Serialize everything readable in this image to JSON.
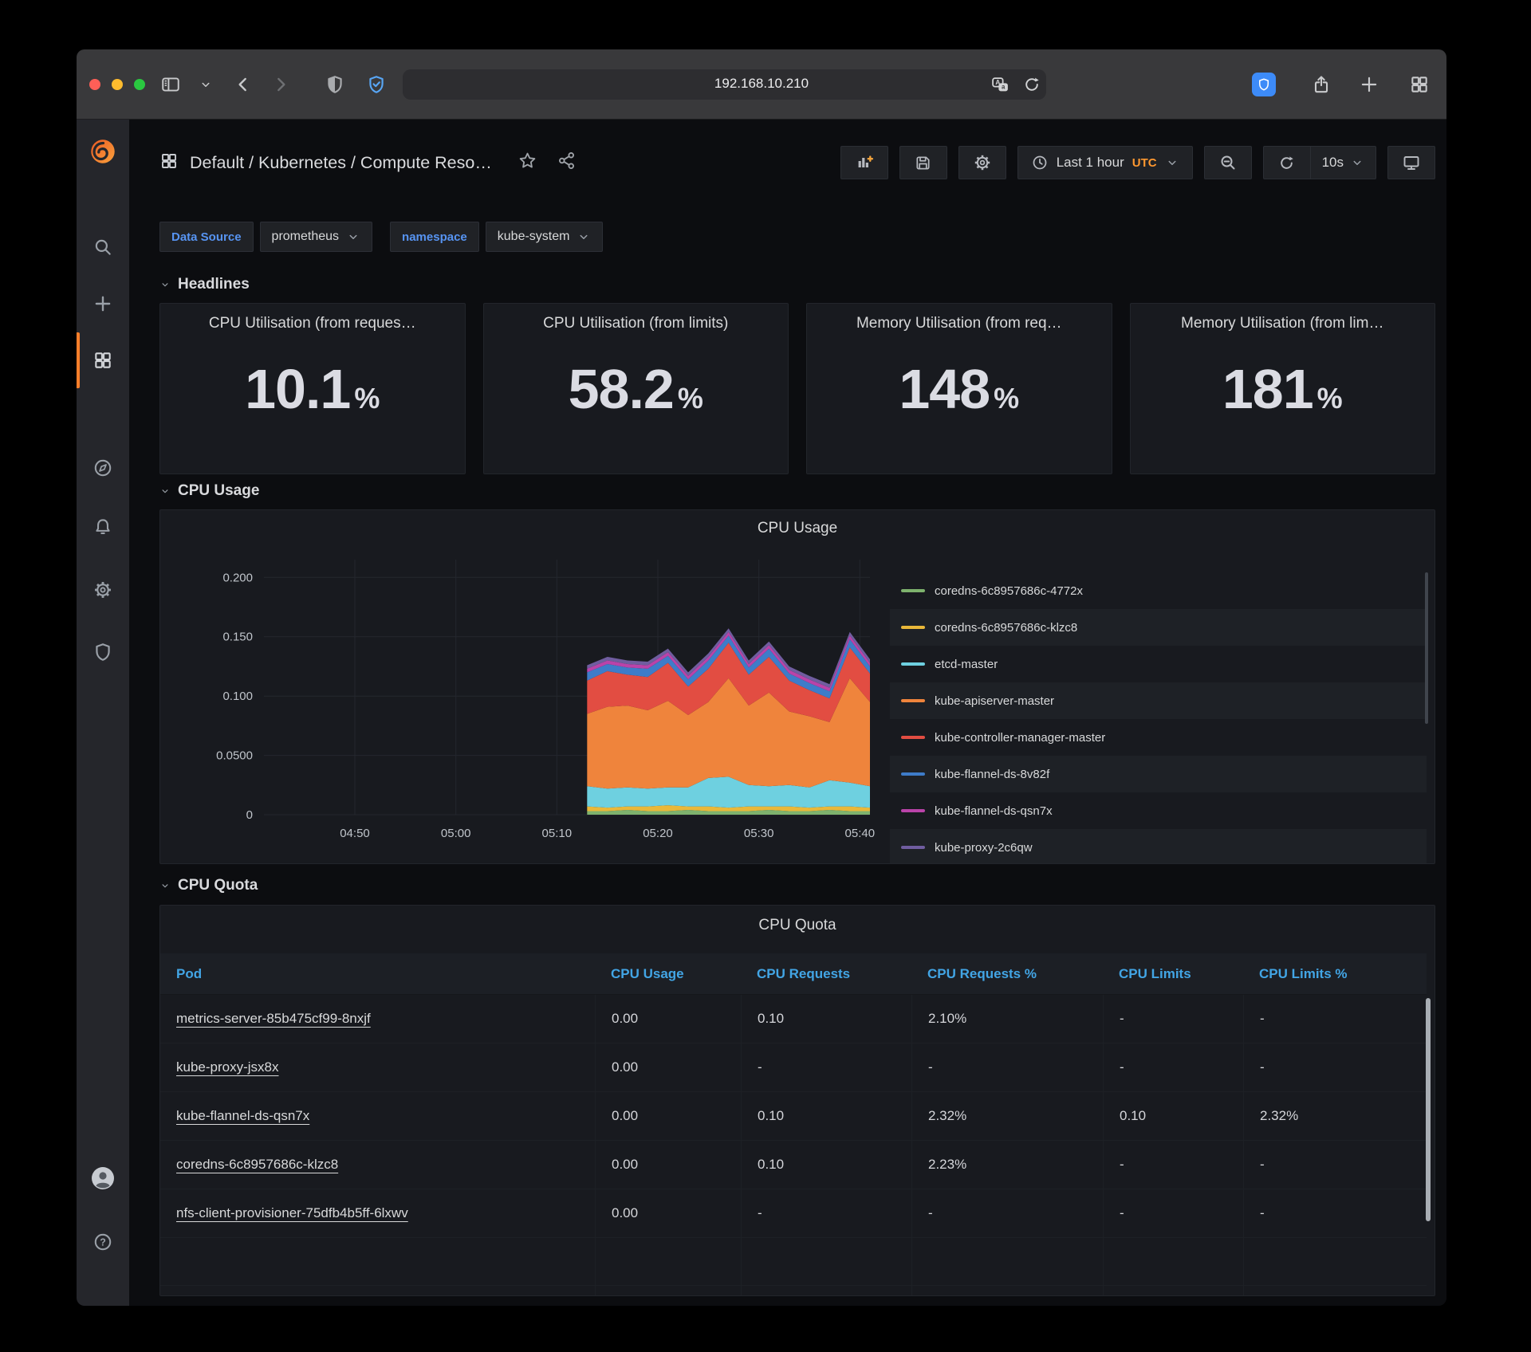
{
  "browser": {
    "url": "192.168.10.210",
    "window_buttons": [
      "close",
      "minimize",
      "zoom"
    ],
    "toolbar_icons": [
      "sidebar-icon",
      "chevron-down-icon",
      "back-icon",
      "forward-icon",
      "privacy-shield-icon",
      "shield-check-icon",
      "translate-icon",
      "reload-icon",
      "bitwarden-icon",
      "share-icon",
      "new-tab-icon",
      "tab-overview-icon"
    ]
  },
  "grafana": {
    "sidebar_icons": [
      "grafana-logo",
      "search-icon",
      "plus-icon",
      "dashboards-icon",
      "explore-compass-icon",
      "alerting-bell-icon",
      "configuration-gear-icon",
      "server-admin-shield-icon",
      "avatar",
      "help-icon"
    ],
    "active_sidebar_item": "dashboards",
    "accent_colors": {
      "link_blue": "#5794F2",
      "table_header_blue": "#42A5E5",
      "orange": "#FF9830",
      "active_bar": "#FF7F2A"
    }
  },
  "dashboard": {
    "breadcrumb": "Default / Kubernetes / Compute Reso…",
    "toolbar": {
      "time_range_label": "Last 1 hour",
      "timezone": "UTC",
      "refresh_interval": "10s",
      "icons": [
        "add-panel-icon",
        "save-icon",
        "settings-gear-icon",
        "clock-icon",
        "zoom-out-icon",
        "refresh-icon",
        "kiosk-tv-icon",
        "star-icon",
        "share-nodes-icon"
      ]
    },
    "variables": [
      {
        "label": "Data Source",
        "value": "prometheus"
      },
      {
        "label": "namespace",
        "value": "kube-system"
      }
    ],
    "sections": [
      {
        "title": "Headlines"
      },
      {
        "title": "CPU Usage"
      },
      {
        "title": "CPU Quota"
      }
    ],
    "stats": [
      {
        "title": "CPU Utilisation (from reques…",
        "value": "10.1",
        "unit": "%"
      },
      {
        "title": "CPU Utilisation (from limits)",
        "value": "58.2",
        "unit": "%"
      },
      {
        "title": "Memory Utilisation (from req…",
        "value": "148",
        "unit": "%"
      },
      {
        "title": "Memory Utilisation (from lim…",
        "value": "181",
        "unit": "%"
      }
    ],
    "table": {
      "title": "CPU Quota",
      "columns": [
        "Pod",
        "CPU Usage",
        "CPU Requests",
        "CPU Requests %",
        "CPU Limits",
        "CPU Limits %"
      ],
      "rows": [
        [
          "metrics-server-85b475cf99-8nxjf",
          "0.00",
          "0.10",
          "2.10%",
          "-",
          "-"
        ],
        [
          "kube-proxy-jsx8x",
          "0.00",
          "-",
          "-",
          "-",
          "-"
        ],
        [
          "kube-flannel-ds-qsn7x",
          "0.00",
          "0.10",
          "2.32%",
          "0.10",
          "2.32%"
        ],
        [
          "coredns-6c8957686c-klzc8",
          "0.00",
          "0.10",
          "2.23%",
          "-",
          "-"
        ],
        [
          "nfs-client-provisioner-75dfb4b5ff-6lxwv",
          "0.00",
          "-",
          "-",
          "-",
          "-"
        ]
      ]
    }
  },
  "chart_data": {
    "type": "area",
    "stacked": true,
    "title": "CPU Usage",
    "legend_position": "right",
    "grid": true,
    "x_range": [
      "04:41",
      "05:41"
    ],
    "x_ticks": [
      "04:50",
      "05:00",
      "05:10",
      "05:20",
      "05:30",
      "05:40"
    ],
    "y_ticks": [
      "0",
      "0.0500",
      "0.100",
      "0.150",
      "0.200"
    ],
    "ylim": [
      0,
      0.215
    ],
    "x": [
      "05:13",
      "05:15",
      "05:17",
      "05:19",
      "05:21",
      "05:23",
      "05:25",
      "05:27",
      "05:29",
      "05:31",
      "05:33",
      "05:35",
      "05:37",
      "05:39",
      "05:41"
    ],
    "series": [
      {
        "name": "coredns-6c8957686c-4772x",
        "color": "#7EB26D",
        "values": [
          0.003,
          0.003,
          0.004,
          0.003,
          0.003,
          0.004,
          0.003,
          0.003,
          0.003,
          0.004,
          0.003,
          0.003,
          0.004,
          0.003,
          0.003
        ]
      },
      {
        "name": "coredns-6c8957686c-klzc8",
        "color": "#EAB839",
        "values": [
          0.004,
          0.003,
          0.003,
          0.004,
          0.005,
          0.003,
          0.004,
          0.003,
          0.004,
          0.003,
          0.004,
          0.003,
          0.003,
          0.004,
          0.003
        ]
      },
      {
        "name": "etcd-master",
        "color": "#6ED0E0",
        "values": [
          0.017,
          0.016,
          0.016,
          0.015,
          0.015,
          0.016,
          0.024,
          0.026,
          0.018,
          0.017,
          0.018,
          0.017,
          0.022,
          0.02,
          0.018
        ]
      },
      {
        "name": "kube-apiserver-master",
        "color": "#EF843C",
        "values": [
          0.061,
          0.069,
          0.069,
          0.066,
          0.073,
          0.061,
          0.064,
          0.083,
          0.067,
          0.079,
          0.062,
          0.06,
          0.049,
          0.088,
          0.071
        ]
      },
      {
        "name": "kube-controller-manager-master",
        "color": "#E24D42",
        "values": [
          0.028,
          0.03,
          0.026,
          0.028,
          0.032,
          0.024,
          0.028,
          0.03,
          0.026,
          0.03,
          0.026,
          0.022,
          0.02,
          0.026,
          0.024
        ]
      },
      {
        "name": "kube-flannel-ds-8v82f",
        "color": "#3E7CC9",
        "values": [
          0.007,
          0.006,
          0.006,
          0.007,
          0.006,
          0.006,
          0.007,
          0.006,
          0.006,
          0.007,
          0.006,
          0.006,
          0.006,
          0.007,
          0.006
        ]
      },
      {
        "name": "kube-flannel-ds-qsn7x",
        "color": "#BA43A9",
        "values": [
          0.003,
          0.003,
          0.003,
          0.003,
          0.003,
          0.003,
          0.003,
          0.003,
          0.003,
          0.003,
          0.003,
          0.003,
          0.003,
          0.003,
          0.003
        ]
      },
      {
        "name": "kube-proxy-2c6qw",
        "color": "#705DA0",
        "values": [
          0.003,
          0.003,
          0.003,
          0.003,
          0.003,
          0.003,
          0.003,
          0.003,
          0.003,
          0.003,
          0.003,
          0.003,
          0.003,
          0.003,
          0.003
        ]
      }
    ]
  }
}
